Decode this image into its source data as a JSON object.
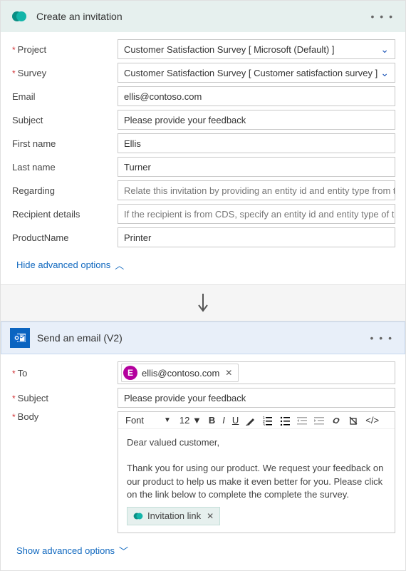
{
  "card1": {
    "title": "Create an invitation",
    "fields": {
      "project": {
        "label": "Project",
        "value": "Customer Satisfaction Survey [ Microsoft (Default) ]"
      },
      "survey": {
        "label": "Survey",
        "value": "Customer Satisfaction Survey [ Customer satisfaction survey ]"
      },
      "email": {
        "label": "Email",
        "value": "ellis@contoso.com"
      },
      "subject": {
        "label": "Subject",
        "value": "Please provide your feedback"
      },
      "firstname": {
        "label": "First name",
        "value": "Ellis"
      },
      "lastname": {
        "label": "Last name",
        "value": "Turner"
      },
      "regarding": {
        "label": "Regarding",
        "placeholder": "Relate this invitation by providing an entity id and entity type from this CDS in t"
      },
      "recipient": {
        "label": "Recipient details",
        "placeholder": "If the recipient is from CDS, specify an entity id and entity type of the recipient t"
      },
      "product": {
        "label": "ProductName",
        "value": "Printer"
      }
    },
    "advToggle": "Hide advanced options"
  },
  "card2": {
    "title": "Send an email (V2)",
    "toLabel": "To",
    "toChip": {
      "initial": "E",
      "email": "ellis@contoso.com"
    },
    "subjectLabel": "Subject",
    "subjectValue": "Please provide your feedback",
    "bodyLabel": "Body",
    "fontLabel": "Font",
    "fontSize": "12",
    "bodyGreeting": "Dear valued customer,",
    "bodyText": "Thank you for using our product. We request your feedback on our product to help us make it even better for you. Please click on the link below to complete the complete the survey.",
    "invitationChip": "Invitation link",
    "advToggle": "Show advanced options"
  }
}
